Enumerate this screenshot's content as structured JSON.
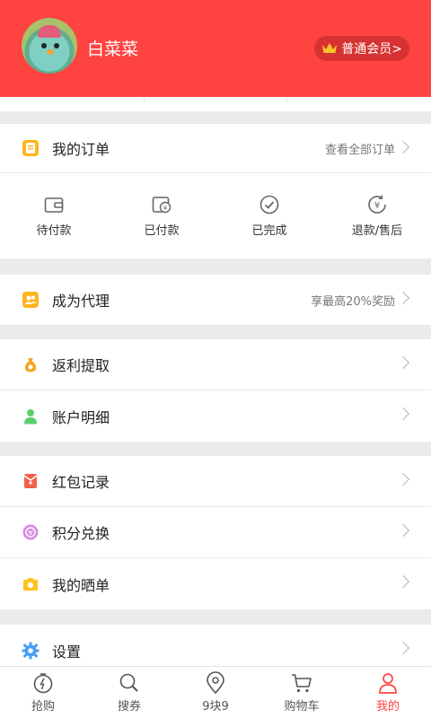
{
  "colors": {
    "brand_red": "#ff4341",
    "active_tab": "#ff4341"
  },
  "profile": {
    "username": "白菜菜",
    "member_label": "普通会员>",
    "avatar_icon": "penguin-avatar"
  },
  "orders": {
    "title": "我的订单",
    "view_all": "查看全部订单",
    "statuses": [
      {
        "label": "待付款",
        "icon": "wallet-icon"
      },
      {
        "label": "已付款",
        "icon": "paid-icon"
      },
      {
        "label": "已完成",
        "icon": "check-circle-icon"
      },
      {
        "label": "退款/售后",
        "icon": "refund-icon"
      }
    ]
  },
  "agent": {
    "title": "成为代理",
    "hint": "享最高20%奖励"
  },
  "menu": {
    "rebate": "返利提取",
    "account": "账户明细",
    "red_packet": "红包记录",
    "points": "积分兑换",
    "showcase": "我的晒单",
    "settings": "设置"
  },
  "bottom_nav": [
    {
      "label": "抢购",
      "icon": "flash-sale-icon"
    },
    {
      "label": "搜券",
      "icon": "coupon-search-icon"
    },
    {
      "label": "9块9",
      "icon": "location-pin-icon"
    },
    {
      "label": "购物车",
      "icon": "cart-icon"
    },
    {
      "label": "我的",
      "icon": "profile-icon",
      "active": true
    }
  ]
}
